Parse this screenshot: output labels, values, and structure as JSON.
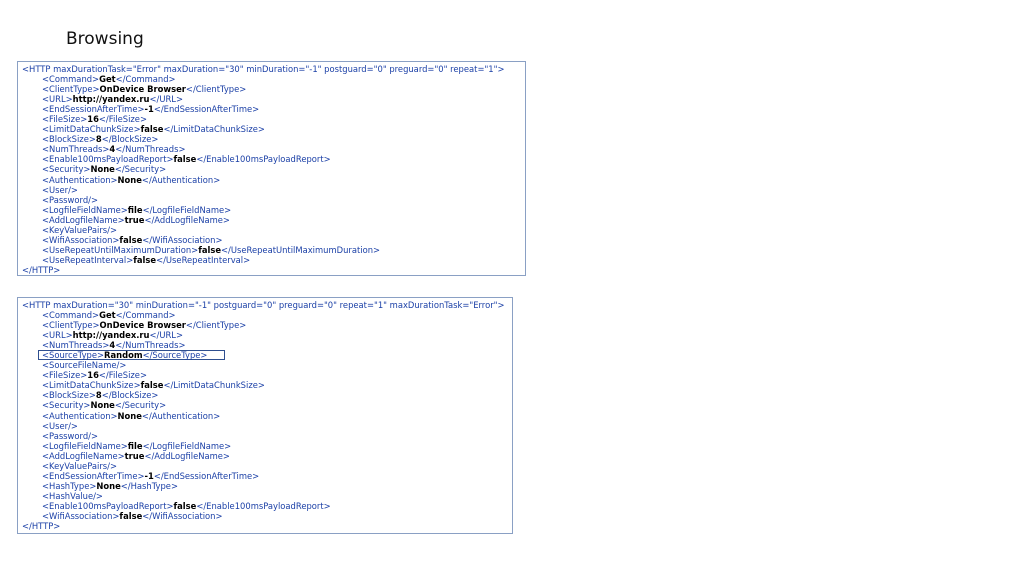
{
  "page": {
    "title": "Browsing"
  },
  "box1": {
    "open": "<HTTP maxDurationTask=\"Error\" maxDuration=\"30\" minDuration=\"-1\" postguard=\"0\" preguard=\"0\" repeat=\"1\">",
    "lines": [
      {
        "o": "<Command>",
        "v": "Get",
        "c": "</Command>"
      },
      {
        "o": "<ClientType>",
        "v": "OnDevice Browser",
        "c": "</ClientType>"
      },
      {
        "o": "<URL>",
        "v": "http://yandex.ru",
        "c": "</URL>"
      },
      {
        "o": "<EndSessionAfterTime>",
        "v": "-1",
        "c": "</EndSessionAfterTime>"
      },
      {
        "o": "<FileSize>",
        "v": "16",
        "c": "</FileSize>"
      },
      {
        "o": "<LimitDataChunkSize>",
        "v": "false",
        "c": "</LimitDataChunkSize>"
      },
      {
        "o": "<BlockSize>",
        "v": "8",
        "c": "</BlockSize>"
      },
      {
        "o": "<NumThreads>",
        "v": "4",
        "c": "</NumThreads>"
      },
      {
        "o": "<Enable100msPayloadReport>",
        "v": "false",
        "c": "</Enable100msPayloadReport>"
      },
      {
        "o": "<Security>",
        "v": "None",
        "c": "</Security>"
      },
      {
        "o": "<Authentication>",
        "v": "None",
        "c": "</Authentication>"
      },
      {
        "o": "<User/>",
        "v": "",
        "c": ""
      },
      {
        "o": "<Password/>",
        "v": "",
        "c": ""
      },
      {
        "o": "<LogfileFieldName>",
        "v": "file",
        "c": "</LogfileFieldName>"
      },
      {
        "o": "<AddLogfileName>",
        "v": "true",
        "c": "</AddLogfileName>"
      },
      {
        "o": "<KeyValuePairs/>",
        "v": "",
        "c": ""
      },
      {
        "o": "<WifiAssociation>",
        "v": "false",
        "c": "</WifiAssociation>"
      },
      {
        "o": "<UseRepeatUntilMaximumDuration>",
        "v": "false",
        "c": "</UseRepeatUntilMaximumDuration>"
      },
      {
        "o": "<UseRepeatInterval>",
        "v": "false",
        "c": "</UseRepeatInterval>"
      }
    ],
    "close": "</HTTP>"
  },
  "box2": {
    "open": "<HTTP maxDuration=\"30\" minDuration=\"-1\" postguard=\"0\" preguard=\"0\" repeat=\"1\" maxDurationTask=\"Error\">",
    "lines": [
      {
        "o": "<Command>",
        "v": "Get",
        "c": "</Command>"
      },
      {
        "o": "<ClientType>",
        "v": "OnDevice Browser",
        "c": "</ClientType>"
      },
      {
        "o": "<URL>",
        "v": "http://yandex.ru",
        "c": "</URL>"
      },
      {
        "o": "<NumThreads>",
        "v": "4",
        "c": "</NumThreads>"
      },
      {
        "o": "<SourceType>",
        "v": "Random",
        "c": "</SourceType>",
        "highlight": true
      },
      {
        "o": "<SourceFileName/>",
        "v": "",
        "c": ""
      },
      {
        "o": "<FileSize>",
        "v": "16",
        "c": "</FileSize>"
      },
      {
        "o": "<LimitDataChunkSize>",
        "v": "false",
        "c": "</LimitDataChunkSize>"
      },
      {
        "o": "<BlockSize>",
        "v": "8",
        "c": "</BlockSize>"
      },
      {
        "o": "<Security>",
        "v": "None",
        "c": "</Security>"
      },
      {
        "o": "<Authentication>",
        "v": "None",
        "c": "</Authentication>"
      },
      {
        "o": "<User/>",
        "v": "",
        "c": ""
      },
      {
        "o": "<Password/>",
        "v": "",
        "c": ""
      },
      {
        "o": "<LogfileFieldName>",
        "v": "file",
        "c": "</LogfileFieldName>"
      },
      {
        "o": "<AddLogfileName>",
        "v": "true",
        "c": "</AddLogfileName>"
      },
      {
        "o": "<KeyValuePairs/>",
        "v": "",
        "c": ""
      },
      {
        "o": "<EndSessionAfterTime>",
        "v": "-1",
        "c": "</EndSessionAfterTime>"
      },
      {
        "o": "<HashType>",
        "v": "None",
        "c": "</HashType>"
      },
      {
        "o": "<HashValue/>",
        "v": "",
        "c": ""
      },
      {
        "o": "<Enable100msPayloadReport>",
        "v": "false",
        "c": "</Enable100msPayloadReport>"
      },
      {
        "o": "<WifiAssociation>",
        "v": "false",
        "c": "</WifiAssociation>"
      }
    ],
    "close": "</HTTP>"
  }
}
